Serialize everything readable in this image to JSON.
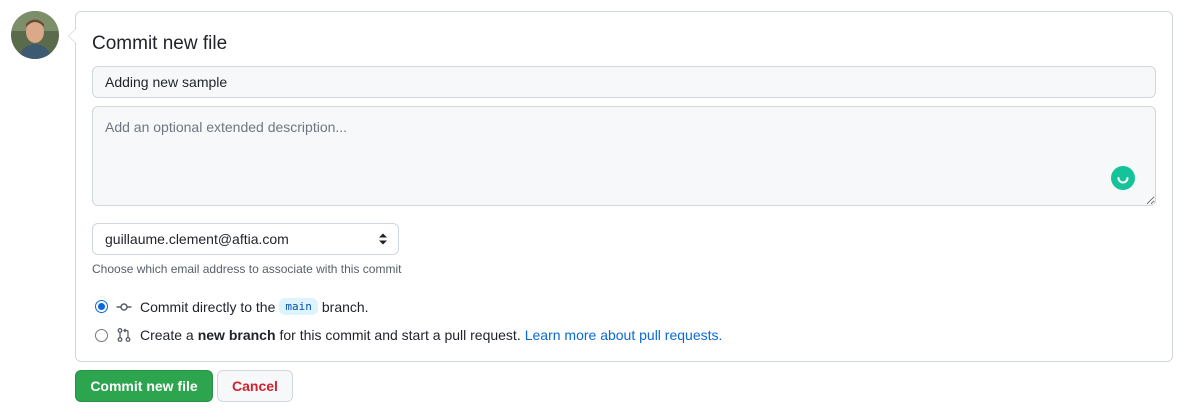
{
  "avatar": {
    "icon": "user-avatar"
  },
  "commit_form": {
    "title": "Commit new file",
    "summary_value": "Adding new sample",
    "description_placeholder": "Add an optional extended description...",
    "email_selected": "guillaume.clement@aftia.com",
    "email_hint": "Choose which email address to associate with this commit",
    "option_direct": {
      "prefix": "Commit directly to the",
      "branch": "main",
      "suffix": "branch.",
      "checked": true
    },
    "option_new_branch": {
      "prefix": "Create a",
      "bold": "new branch",
      "suffix": "for this commit and start a pull request.",
      "link": "Learn more about pull requests.",
      "checked": false
    }
  },
  "actions": {
    "commit_label": "Commit new file",
    "cancel_label": "Cancel"
  },
  "colors": {
    "primary_button": "#2da44e",
    "cancel_text": "#cf222e",
    "link": "#0969da",
    "grammarly": "#15c39a"
  }
}
